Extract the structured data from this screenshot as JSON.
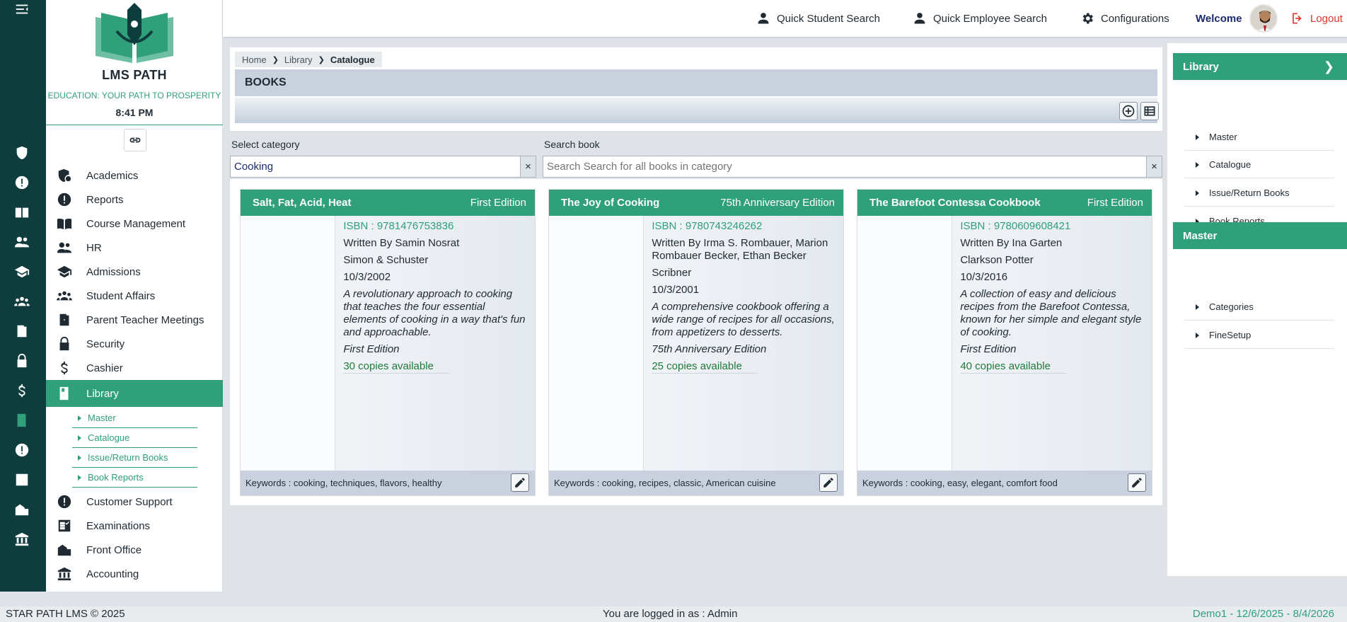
{
  "brand": {
    "name": "LMS PATH",
    "tagline": "EDUCATION: YOUR PATH TO PROSPERITY",
    "time": "8:41 PM"
  },
  "topbar": {
    "quick_student": "Quick Student Search",
    "quick_employee": "Quick Employee Search",
    "configurations": "Configurations",
    "welcome": "Welcome",
    "logout": "Logout"
  },
  "nav": {
    "items": [
      {
        "label": "Academics",
        "icon": "shield-gear-icon"
      },
      {
        "label": "Reports",
        "icon": "alert-icon"
      },
      {
        "label": "Course Management",
        "icon": "book-open-icon"
      },
      {
        "label": "HR",
        "icon": "people-icon"
      },
      {
        "label": "Admissions",
        "icon": "graduation-cap-icon"
      },
      {
        "label": "Student Affairs",
        "icon": "group-icon"
      },
      {
        "label": "Parent Teacher Meetings",
        "icon": "door-icon"
      },
      {
        "label": "Security",
        "icon": "lock-icon"
      },
      {
        "label": "Cashier",
        "icon": "dollar-icon"
      },
      {
        "label": "Library",
        "icon": "book-icon"
      },
      {
        "label": "Customer Support",
        "icon": "alert-icon"
      },
      {
        "label": "Examinations",
        "icon": "checklist-icon"
      },
      {
        "label": "Front Office",
        "icon": "building-icon"
      },
      {
        "label": "Accounting",
        "icon": "bank-icon"
      }
    ],
    "library_sub": [
      "Master",
      "Catalogue",
      "Issue/Return Books",
      "Book Reports"
    ]
  },
  "breadcrumb": {
    "home": "Home",
    "library": "Library",
    "current": "Catalogue"
  },
  "page_title": "BOOKS",
  "filters": {
    "category_label": "Select category",
    "category_value": "Cooking",
    "search_label": "Search book",
    "search_placeholder": "Search Search for all books in category",
    "clear": "×"
  },
  "books": [
    {
      "title": "Salt, Fat, Acid, Heat",
      "edition": "First Edition",
      "isbn": "ISBN : 9781476753836",
      "author": "Written By Samin Nosrat",
      "publisher": "Simon & Schuster",
      "date": "10/3/2002",
      "description": "A revolutionary approach to cooking that teaches the four essential elements of cooking in a way that's fun and approachable.",
      "edition_note": "First Edition",
      "copies": "30 copies available",
      "keywords": "Keywords : cooking, techniques, flavors, healthy"
    },
    {
      "title": "The Joy of Cooking",
      "edition": "75th Anniversary Edition",
      "isbn": "ISBN : 9780743246262",
      "author": "Written By Irma S. Rombauer, Marion Rombauer Becker, Ethan Becker",
      "publisher": "Scribner",
      "date": "10/3/2001",
      "description": "A comprehensive cookbook offering a wide range of recipes for all occasions, from appetizers to desserts.",
      "edition_note": "75th Anniversary Edition",
      "copies": "25 copies available",
      "keywords": "Keywords : cooking, recipes, classic, American cuisine"
    },
    {
      "title": "The Barefoot Contessa Cookbook",
      "edition": "First Edition",
      "isbn": "ISBN : 9780609608421",
      "author": "Written By Ina Garten",
      "publisher": "Clarkson Potter",
      "date": "10/3/2016",
      "description": "A collection of easy and delicious recipes from the Barefoot Contessa, known for her simple and elegant style of cooking.",
      "edition_note": "First Edition",
      "copies": "40 copies available",
      "keywords": "Keywords : cooking, easy, elegant, comfort food"
    }
  ],
  "rightbar": {
    "library_title": "Library",
    "library_items": [
      "Master",
      "Catalogue",
      "Issue/Return Books",
      "Book Reports"
    ],
    "master_title": "Master",
    "master_items": [
      "Categories",
      "FineSetup"
    ]
  },
  "footer": {
    "copyright": "STAR PATH LMS © 2025",
    "logged_in": "You are logged in as : Admin",
    "session": "Demo1 -  12/6/2025 - 8/4/2026"
  },
  "colors": {
    "accent": "#2fa07a",
    "rail": "#0f3d3e",
    "header_bar": "#c8d1dd"
  }
}
